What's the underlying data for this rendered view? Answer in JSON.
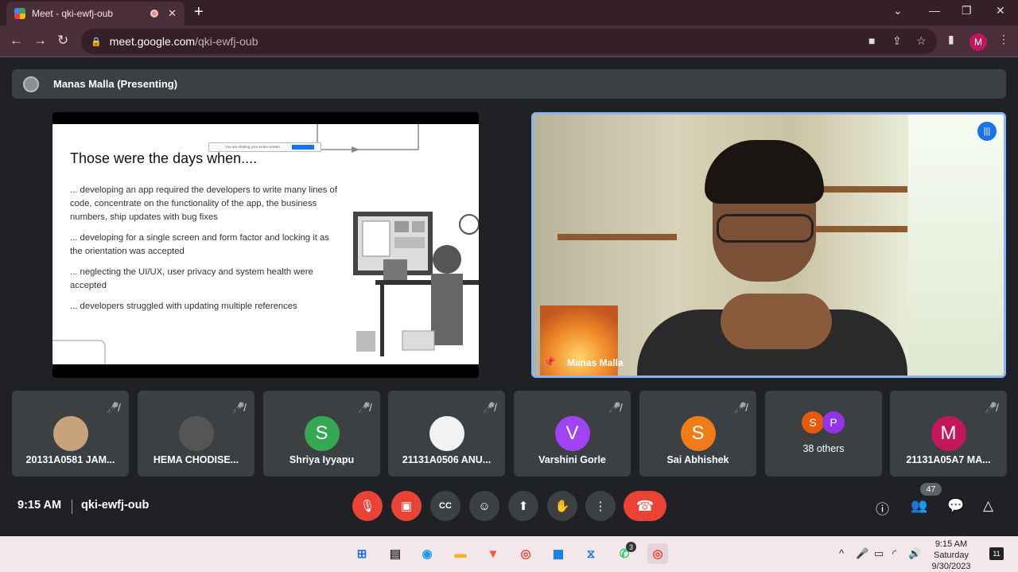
{
  "browser": {
    "tab_title": "Meet - qki-ewfj-oub",
    "url_host": "meet.google.com",
    "url_path": "/qki-ewfj-oub",
    "profile_initial": "M"
  },
  "presenting": {
    "label": "Manas Malla (Presenting)"
  },
  "slide": {
    "title": "Those were the days when....",
    "bullets": [
      "... developing an app required the developers to write many lines of code, concentrate on the functionality of the app, the business numbers, ship updates with bug fixes",
      "... developing for a single screen and form factor and locking it as the orientation was accepted",
      "... neglecting the UI/UX, user privacy and system health were accepted",
      "... developers struggled with updating multiple references"
    ],
    "share_notice": "You are sharing your entire screen."
  },
  "camera": {
    "name": "Manas Malla"
  },
  "participants": [
    {
      "name": "20131A0581 JAM...",
      "initial": "",
      "color": "#c8a27a"
    },
    {
      "name": "HEMA CHODISE...",
      "initial": "",
      "color": "#555"
    },
    {
      "name": "Shriya Iyyapu",
      "initial": "S",
      "color": "#34a853"
    },
    {
      "name": "21131A0506 ANU...",
      "initial": "",
      "color": "#f2f2f2"
    },
    {
      "name": "Varshini Gorle",
      "initial": "V",
      "color": "#a142f4"
    },
    {
      "name": "Sai Abhishek",
      "initial": "S",
      "color": "#f07c19"
    },
    {
      "name": "21131A05A7 MA...",
      "initial": "M",
      "color": "#c2185b"
    }
  ],
  "others_tile": {
    "label": "38 others",
    "initial_1": "S",
    "initial_2": "P",
    "color_1": "#e8590c",
    "color_2": "#9334e6"
  },
  "meeting": {
    "time": "9:15 AM",
    "code": "qki-ewfj-oub",
    "people_count": "47"
  },
  "taskbar": {
    "whatsapp_badge": "3",
    "clock_time": "9:15 AM",
    "clock_day": "Saturday",
    "clock_date": "9/30/2023",
    "notification_count": "11"
  }
}
